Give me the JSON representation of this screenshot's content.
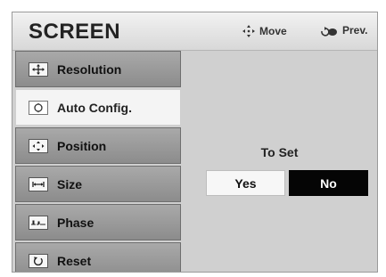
{
  "header": {
    "title": "SCREEN",
    "move_label": "Move",
    "prev_label": "Prev."
  },
  "sidebar": {
    "items": [
      {
        "label": "Resolution",
        "icon": "resolution-icon",
        "active": false
      },
      {
        "label": "Auto Config.",
        "icon": "auto-config-icon",
        "active": true
      },
      {
        "label": "Position",
        "icon": "position-icon",
        "active": false
      },
      {
        "label": "Size",
        "icon": "size-icon",
        "active": false
      },
      {
        "label": "Phase",
        "icon": "phase-icon",
        "active": false
      },
      {
        "label": "Reset",
        "icon": "reset-icon",
        "active": false
      }
    ]
  },
  "panel": {
    "prompt": "To Set",
    "yes_label": "Yes",
    "no_label": "No",
    "selected": "No"
  },
  "colors": {
    "background": "#d0d0d0",
    "menu_item": "#9a9a9a",
    "active_item": "#f4f4f4",
    "selected_button": "#050505"
  }
}
